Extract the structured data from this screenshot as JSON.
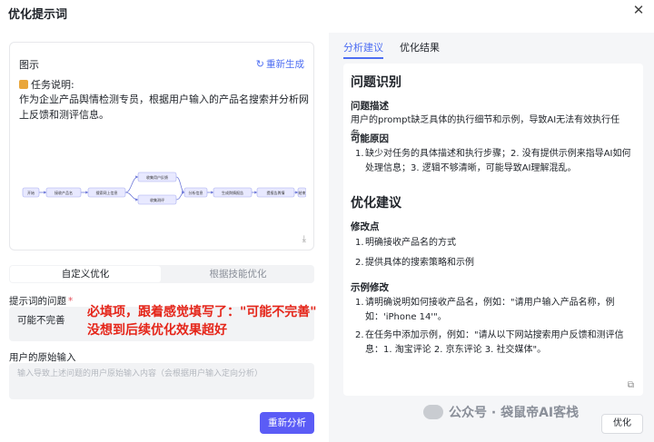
{
  "window": {
    "title": "优化提示词",
    "close_glyph": "✕"
  },
  "preview_card": {
    "title": "图示",
    "regenerate_label": "重新生成",
    "task_heading": "任务说明:",
    "task_description": "作为企业产品舆情检测专员，根据用户输入的产品名搜索并分析网上反馈和测评信息。",
    "flow_nodes": {
      "start": "开始",
      "receive": "接收产品名",
      "search": "搜索网上信息",
      "collect_feedback": "收集用户反馈",
      "collect_review": "收集测评",
      "analyze": "分析信息",
      "report": "生成舆情报告",
      "submit": "提报告舆情",
      "end": "结束"
    }
  },
  "mode_tabs": [
    "自定义优化",
    "根据技能优化"
  ],
  "prompt_issue": {
    "label": "提示词的问题",
    "required_mark": "*",
    "value": "可能不完善"
  },
  "annotation": {
    "line1": "必填项，跟着感觉填写了：\"可能不完善\"",
    "line2": "没想到后续优化效果超好"
  },
  "original_input": {
    "label": "用户的原始输入",
    "placeholder": "输入导致上述问题的用户原始输入内容（会根据用户输入定向分析）"
  },
  "analyze_button": "重新分析",
  "right_tabs": [
    "分析建议",
    "优化结果"
  ],
  "analysis": {
    "section1_title": "问题识别",
    "problem_desc_title": "问题描述",
    "problem_desc": "用户的prompt缺乏具体的执行细节和示例，导致AI无法有效执行任务。",
    "causes_title": "可能原因",
    "causes": [
      "缺少对任务的具体描述和执行步骤；2. 没有提供示例来指导AI如何处理信息；3. 逻辑不够清晰，可能导致AI理解混乱。"
    ],
    "section2_title": "优化建议",
    "changes_title": "修改点",
    "changes": [
      "明确接收产品名的方式",
      "提供具体的搜索策略和示例"
    ],
    "examples_title": "示例修改",
    "examples": [
      "请明确说明如何接收产品名，例如：\"请用户输入产品名称，例如：'iPhone 14'\"。",
      "在任务中添加示例，例如：\"请从以下网站搜索用户反馈和测评信息：1. 淘宝评论 2. 京东评论 3. 社交媒体\"。"
    ]
  },
  "watermark": "公众号 · 袋鼠帝AI客栈",
  "optimize_button": "优化",
  "colors": {
    "accent": "#4e6ef2",
    "button": "#5b5cf6",
    "annotation": "#e5261a"
  }
}
